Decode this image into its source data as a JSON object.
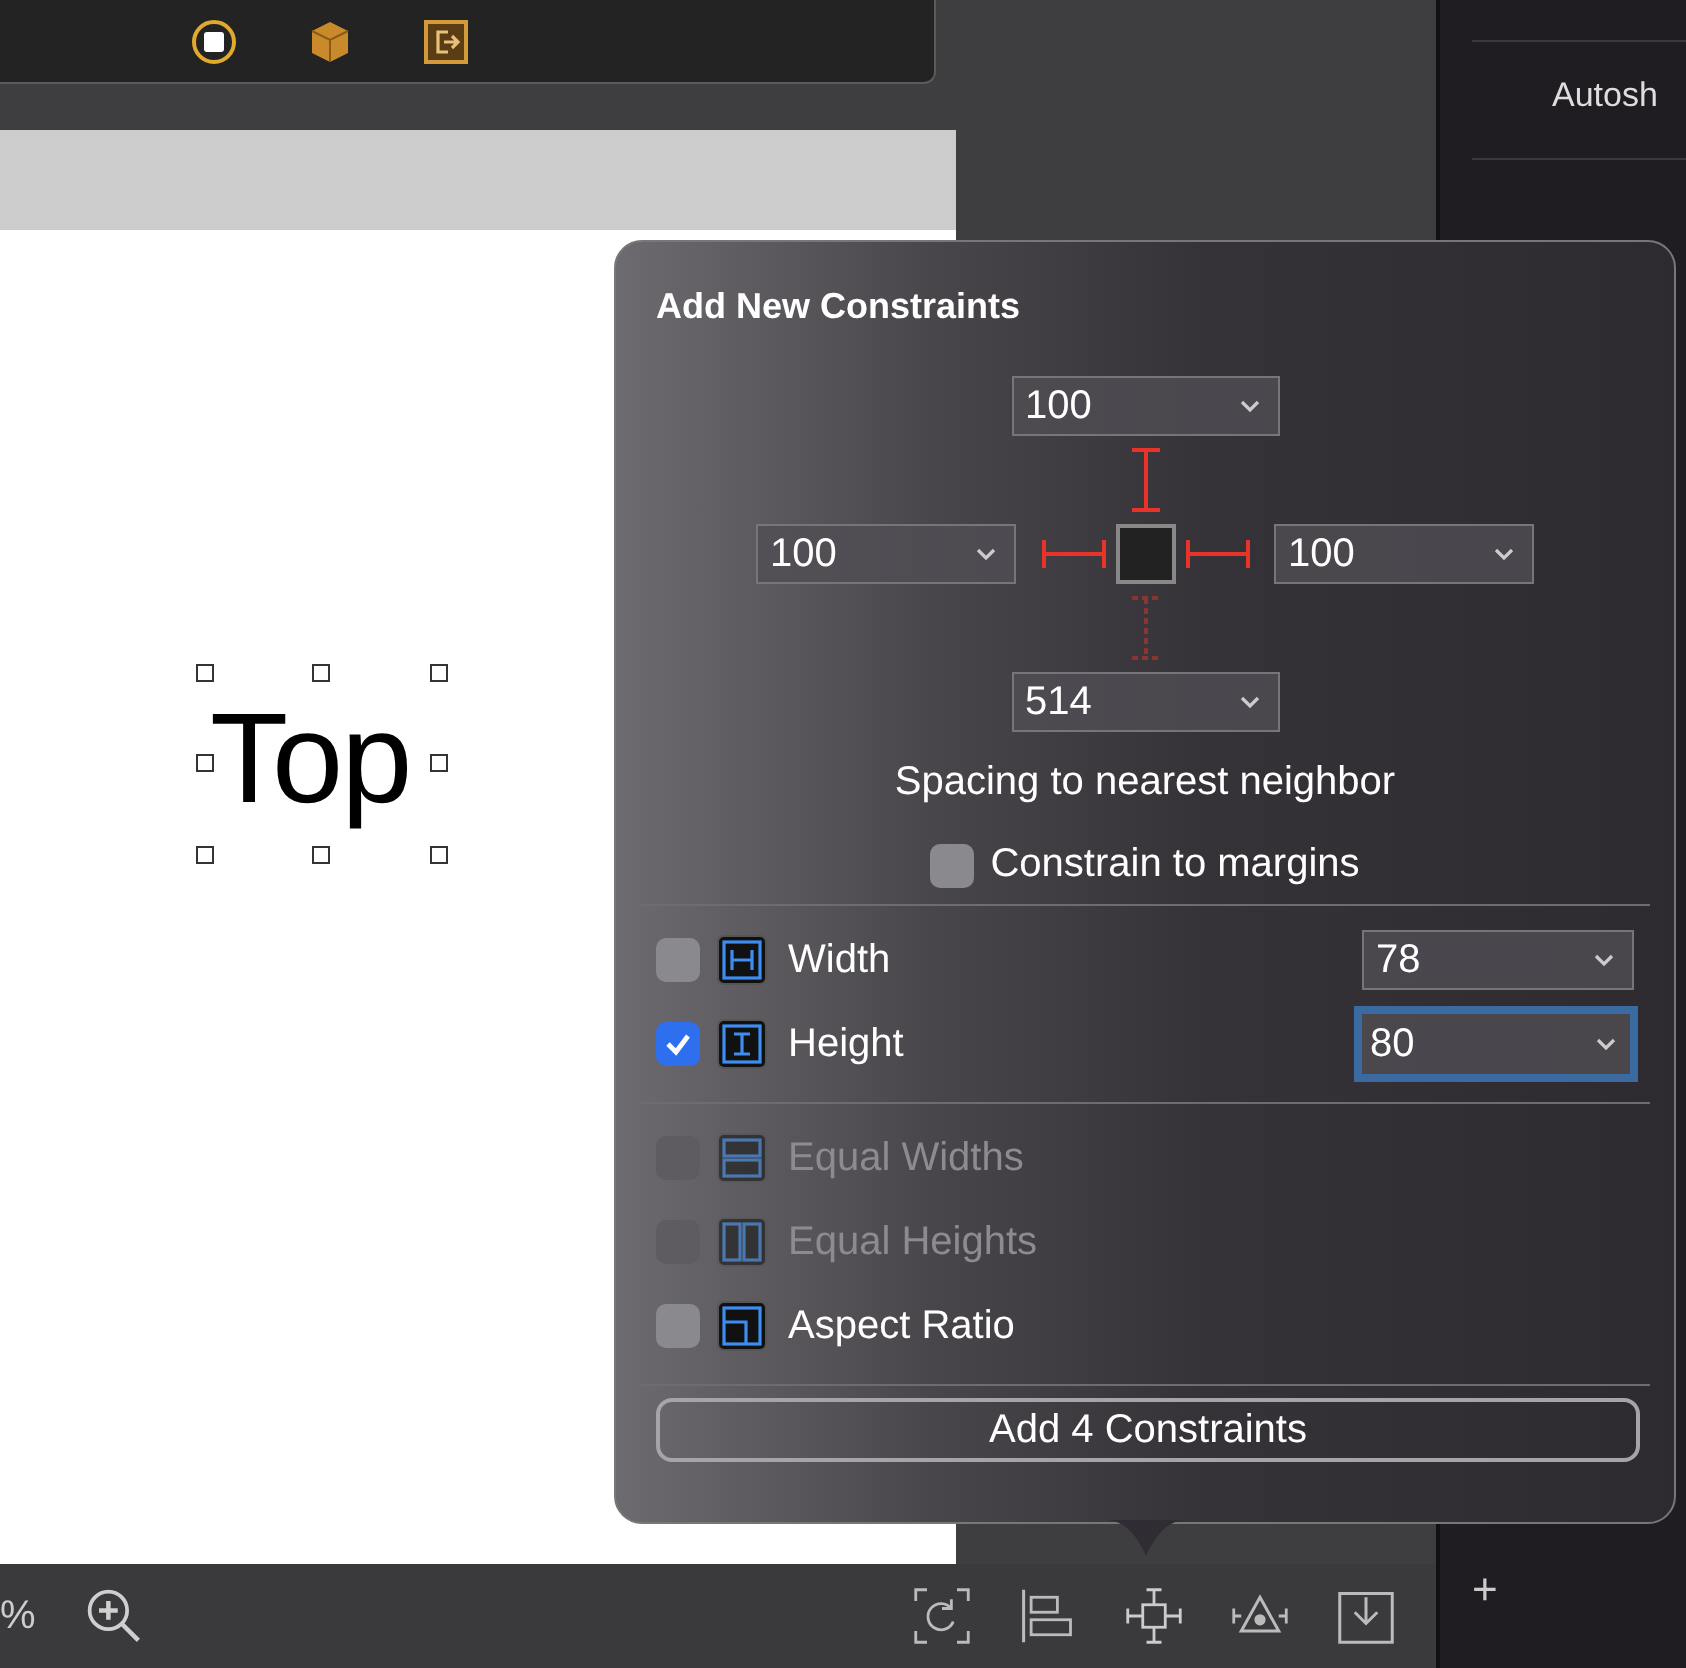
{
  "canvas": {
    "label": "Top"
  },
  "inspector": {
    "label": "Autosh"
  },
  "popover": {
    "title": "Add New Constraints",
    "spacing": {
      "top": {
        "value": "100",
        "active": true
      },
      "left": {
        "value": "100",
        "active": true
      },
      "right": {
        "value": "100",
        "active": true
      },
      "bottom": {
        "value": "514",
        "active": false
      }
    },
    "spacing_caption": "Spacing to nearest neighbor",
    "constrain_to_margins": {
      "label": "Constrain to margins",
      "checked": false
    },
    "size_rows": [
      {
        "kind": "width",
        "label": "Width",
        "checked": false,
        "disabled": false,
        "value": "78",
        "focused": false
      },
      {
        "kind": "height",
        "label": "Height",
        "checked": true,
        "disabled": false,
        "value": "80",
        "focused": true
      }
    ],
    "relation_rows": [
      {
        "kind": "equal_widths",
        "label": "Equal Widths",
        "checked": false,
        "disabled": true
      },
      {
        "kind": "equal_heights",
        "label": "Equal Heights",
        "checked": false,
        "disabled": true
      },
      {
        "kind": "aspect_ratio",
        "label": "Aspect Ratio",
        "checked": false,
        "disabled": false
      }
    ],
    "add_button": "Add 4 Constraints"
  },
  "bottom_bar": {
    "zoom_text": "%"
  },
  "sidebar_add": "+"
}
